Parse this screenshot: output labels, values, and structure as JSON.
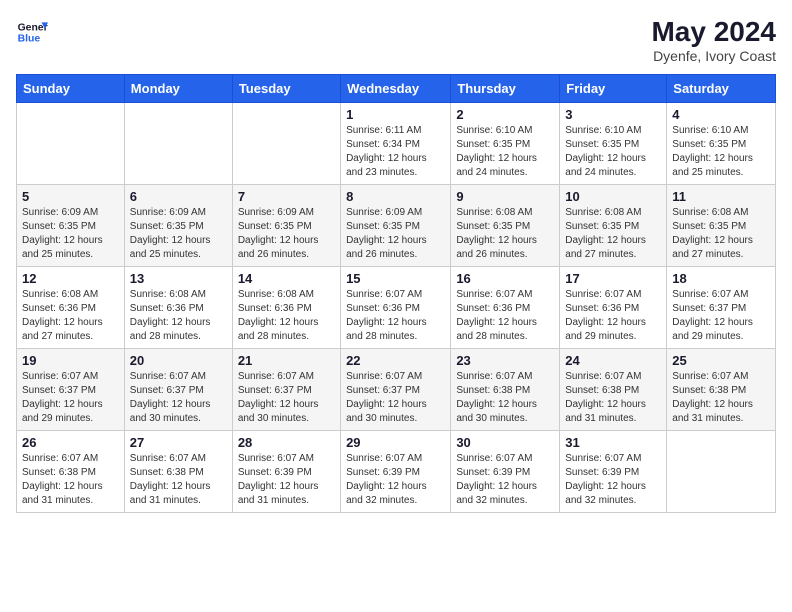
{
  "header": {
    "logo_general": "General",
    "logo_blue": "Blue",
    "month_year": "May 2024",
    "location": "Dyenfe, Ivory Coast"
  },
  "weekdays": [
    "Sunday",
    "Monday",
    "Tuesday",
    "Wednesday",
    "Thursday",
    "Friday",
    "Saturday"
  ],
  "weeks": [
    [
      {
        "day": "",
        "sunrise": "",
        "sunset": "",
        "daylight": ""
      },
      {
        "day": "",
        "sunrise": "",
        "sunset": "",
        "daylight": ""
      },
      {
        "day": "",
        "sunrise": "",
        "sunset": "",
        "daylight": ""
      },
      {
        "day": "1",
        "sunrise": "Sunrise: 6:11 AM",
        "sunset": "Sunset: 6:34 PM",
        "daylight": "Daylight: 12 hours and 23 minutes."
      },
      {
        "day": "2",
        "sunrise": "Sunrise: 6:10 AM",
        "sunset": "Sunset: 6:35 PM",
        "daylight": "Daylight: 12 hours and 24 minutes."
      },
      {
        "day": "3",
        "sunrise": "Sunrise: 6:10 AM",
        "sunset": "Sunset: 6:35 PM",
        "daylight": "Daylight: 12 hours and 24 minutes."
      },
      {
        "day": "4",
        "sunrise": "Sunrise: 6:10 AM",
        "sunset": "Sunset: 6:35 PM",
        "daylight": "Daylight: 12 hours and 25 minutes."
      }
    ],
    [
      {
        "day": "5",
        "sunrise": "Sunrise: 6:09 AM",
        "sunset": "Sunset: 6:35 PM",
        "daylight": "Daylight: 12 hours and 25 minutes."
      },
      {
        "day": "6",
        "sunrise": "Sunrise: 6:09 AM",
        "sunset": "Sunset: 6:35 PM",
        "daylight": "Daylight: 12 hours and 25 minutes."
      },
      {
        "day": "7",
        "sunrise": "Sunrise: 6:09 AM",
        "sunset": "Sunset: 6:35 PM",
        "daylight": "Daylight: 12 hours and 26 minutes."
      },
      {
        "day": "8",
        "sunrise": "Sunrise: 6:09 AM",
        "sunset": "Sunset: 6:35 PM",
        "daylight": "Daylight: 12 hours and 26 minutes."
      },
      {
        "day": "9",
        "sunrise": "Sunrise: 6:08 AM",
        "sunset": "Sunset: 6:35 PM",
        "daylight": "Daylight: 12 hours and 26 minutes."
      },
      {
        "day": "10",
        "sunrise": "Sunrise: 6:08 AM",
        "sunset": "Sunset: 6:35 PM",
        "daylight": "Daylight: 12 hours and 27 minutes."
      },
      {
        "day": "11",
        "sunrise": "Sunrise: 6:08 AM",
        "sunset": "Sunset: 6:35 PM",
        "daylight": "Daylight: 12 hours and 27 minutes."
      }
    ],
    [
      {
        "day": "12",
        "sunrise": "Sunrise: 6:08 AM",
        "sunset": "Sunset: 6:36 PM",
        "daylight": "Daylight: 12 hours and 27 minutes."
      },
      {
        "day": "13",
        "sunrise": "Sunrise: 6:08 AM",
        "sunset": "Sunset: 6:36 PM",
        "daylight": "Daylight: 12 hours and 28 minutes."
      },
      {
        "day": "14",
        "sunrise": "Sunrise: 6:08 AM",
        "sunset": "Sunset: 6:36 PM",
        "daylight": "Daylight: 12 hours and 28 minutes."
      },
      {
        "day": "15",
        "sunrise": "Sunrise: 6:07 AM",
        "sunset": "Sunset: 6:36 PM",
        "daylight": "Daylight: 12 hours and 28 minutes."
      },
      {
        "day": "16",
        "sunrise": "Sunrise: 6:07 AM",
        "sunset": "Sunset: 6:36 PM",
        "daylight": "Daylight: 12 hours and 28 minutes."
      },
      {
        "day": "17",
        "sunrise": "Sunrise: 6:07 AM",
        "sunset": "Sunset: 6:36 PM",
        "daylight": "Daylight: 12 hours and 29 minutes."
      },
      {
        "day": "18",
        "sunrise": "Sunrise: 6:07 AM",
        "sunset": "Sunset: 6:37 PM",
        "daylight": "Daylight: 12 hours and 29 minutes."
      }
    ],
    [
      {
        "day": "19",
        "sunrise": "Sunrise: 6:07 AM",
        "sunset": "Sunset: 6:37 PM",
        "daylight": "Daylight: 12 hours and 29 minutes."
      },
      {
        "day": "20",
        "sunrise": "Sunrise: 6:07 AM",
        "sunset": "Sunset: 6:37 PM",
        "daylight": "Daylight: 12 hours and 30 minutes."
      },
      {
        "day": "21",
        "sunrise": "Sunrise: 6:07 AM",
        "sunset": "Sunset: 6:37 PM",
        "daylight": "Daylight: 12 hours and 30 minutes."
      },
      {
        "day": "22",
        "sunrise": "Sunrise: 6:07 AM",
        "sunset": "Sunset: 6:37 PM",
        "daylight": "Daylight: 12 hours and 30 minutes."
      },
      {
        "day": "23",
        "sunrise": "Sunrise: 6:07 AM",
        "sunset": "Sunset: 6:38 PM",
        "daylight": "Daylight: 12 hours and 30 minutes."
      },
      {
        "day": "24",
        "sunrise": "Sunrise: 6:07 AM",
        "sunset": "Sunset: 6:38 PM",
        "daylight": "Daylight: 12 hours and 31 minutes."
      },
      {
        "day": "25",
        "sunrise": "Sunrise: 6:07 AM",
        "sunset": "Sunset: 6:38 PM",
        "daylight": "Daylight: 12 hours and 31 minutes."
      }
    ],
    [
      {
        "day": "26",
        "sunrise": "Sunrise: 6:07 AM",
        "sunset": "Sunset: 6:38 PM",
        "daylight": "Daylight: 12 hours and 31 minutes."
      },
      {
        "day": "27",
        "sunrise": "Sunrise: 6:07 AM",
        "sunset": "Sunset: 6:38 PM",
        "daylight": "Daylight: 12 hours and 31 minutes."
      },
      {
        "day": "28",
        "sunrise": "Sunrise: 6:07 AM",
        "sunset": "Sunset: 6:39 PM",
        "daylight": "Daylight: 12 hours and 31 minutes."
      },
      {
        "day": "29",
        "sunrise": "Sunrise: 6:07 AM",
        "sunset": "Sunset: 6:39 PM",
        "daylight": "Daylight: 12 hours and 32 minutes."
      },
      {
        "day": "30",
        "sunrise": "Sunrise: 6:07 AM",
        "sunset": "Sunset: 6:39 PM",
        "daylight": "Daylight: 12 hours and 32 minutes."
      },
      {
        "day": "31",
        "sunrise": "Sunrise: 6:07 AM",
        "sunset": "Sunset: 6:39 PM",
        "daylight": "Daylight: 12 hours and 32 minutes."
      },
      {
        "day": "",
        "sunrise": "",
        "sunset": "",
        "daylight": ""
      }
    ]
  ]
}
